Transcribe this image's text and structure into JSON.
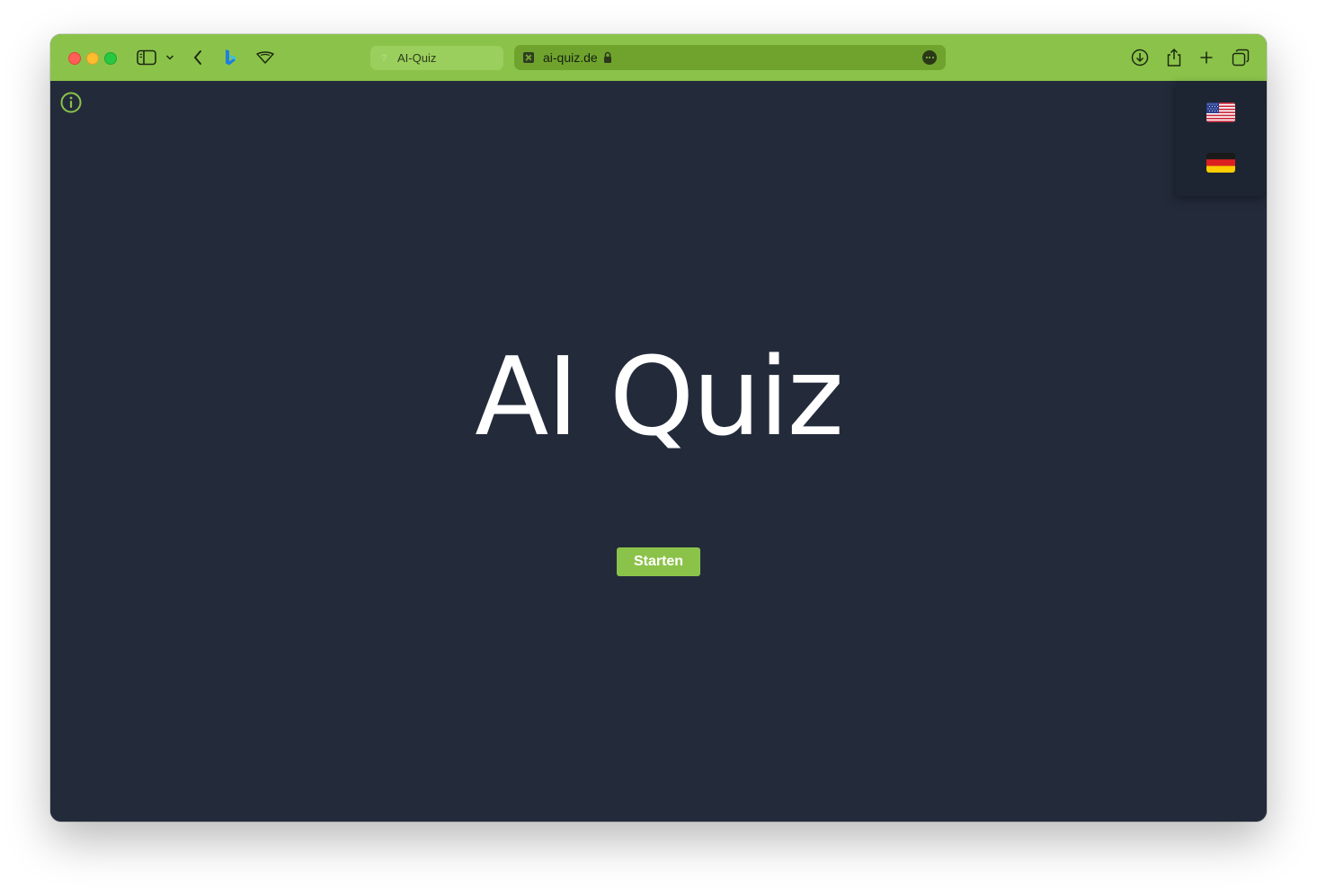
{
  "browser": {
    "tab_title": "AI-Quiz",
    "address": "ai-quiz.de",
    "accent_color": "#8bc34a",
    "icons": [
      "sidebar-icon",
      "chevron-down-icon",
      "back-icon",
      "bing-icon",
      "shield-icon",
      "download-icon",
      "share-icon",
      "new-tab-icon",
      "tabs-overview-icon"
    ]
  },
  "page": {
    "background_color": "#232b3b",
    "title": "AI Quiz",
    "start_button_label": "Starten",
    "languages": [
      {
        "code": "en-US",
        "icon": "us-flag-icon"
      },
      {
        "code": "de",
        "icon": "de-flag-icon"
      }
    ]
  }
}
